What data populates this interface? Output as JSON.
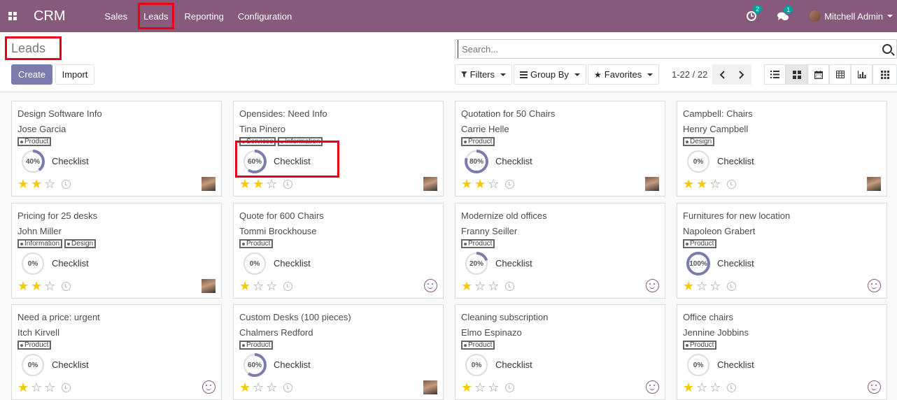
{
  "navbar": {
    "brand": "CRM",
    "menu": [
      "Sales",
      "Leads",
      "Reporting",
      "Configuration"
    ],
    "active_menu": "Leads",
    "activity_count": "2",
    "message_count": "1",
    "user_name": "Mitchell Admin"
  },
  "control": {
    "title": "Leads",
    "create_label": "Create",
    "import_label": "Import",
    "search_placeholder": "Search...",
    "filters_label": "Filters",
    "groupby_label": "Group By",
    "favorites_label": "Favorites",
    "pager": "1-22 / 22",
    "active_view": "kanban"
  },
  "colors": {
    "navbar": "#875a7b",
    "primary": "#7c7bad",
    "star": "#f3cc00",
    "highlight": "#e8001b",
    "badge": "#00a09d"
  },
  "cards": [
    {
      "title": "Design Software Info",
      "contact": "Jose Garcia",
      "tags": [
        "Product"
      ],
      "progress": "40%",
      "checklist": "Checklist",
      "stars": 2,
      "owner": "avatar"
    },
    {
      "title": "Opensides: Need Info",
      "contact": "Tina Pinero",
      "tags": [
        "Services",
        "Information"
      ],
      "progress": "60%",
      "checklist": "Checklist",
      "stars": 2,
      "owner": "avatar"
    },
    {
      "title": "Quotation for 50 Chairs",
      "contact": "Carrie Helle",
      "tags": [
        "Product"
      ],
      "progress": "80%",
      "checklist": "Checklist",
      "stars": 2,
      "owner": "avatar"
    },
    {
      "title": "Campbell: Chairs",
      "contact": "Henry Campbell",
      "tags": [
        "Design"
      ],
      "progress": "0%",
      "checklist": "Checklist",
      "stars": 2,
      "owner": "avatar"
    },
    {
      "title": "Pricing for 25 desks",
      "contact": "John Miller",
      "tags": [
        "Information",
        "Design"
      ],
      "progress": "0%",
      "checklist": "Checklist",
      "stars": 2,
      "owner": "avatar"
    },
    {
      "title": "Quote for 600 Chairs",
      "contact": "Tommi Brockhouse",
      "tags": [
        "Product"
      ],
      "progress": "0%",
      "checklist": "Checklist",
      "stars": 1,
      "owner": "smiley"
    },
    {
      "title": "Modernize old offices",
      "contact": "Franny Seiller",
      "tags": [
        "Product"
      ],
      "progress": "20%",
      "checklist": "Checklist",
      "stars": 1,
      "owner": "smiley"
    },
    {
      "title": "Furnitures for new location",
      "contact": "Napoleon Grabert",
      "tags": [
        "Product"
      ],
      "progress": "100%",
      "checklist": "Checklist",
      "stars": 1,
      "owner": "smiley"
    },
    {
      "title": "Need a price: urgent",
      "contact": "Itch Kirvell",
      "tags": [
        "Product"
      ],
      "progress": "0%",
      "checklist": "Checklist",
      "stars": 1,
      "owner": "smiley"
    },
    {
      "title": "Custom Desks (100 pieces)",
      "contact": "Chalmers Redford",
      "tags": [
        "Product"
      ],
      "progress": "60%",
      "checklist": "Checklist",
      "stars": 1,
      "owner": "avatar"
    },
    {
      "title": "Cleaning subscription",
      "contact": "Elmo Espinazo",
      "tags": [
        "Product"
      ],
      "progress": "0%",
      "checklist": "Checklist",
      "stars": 1,
      "owner": "smiley"
    },
    {
      "title": "Office chairs",
      "contact": "Jennine Jobbins",
      "tags": [
        "Product"
      ],
      "progress": "0%",
      "checklist": "Checklist",
      "stars": 1,
      "owner": "smiley"
    }
  ]
}
